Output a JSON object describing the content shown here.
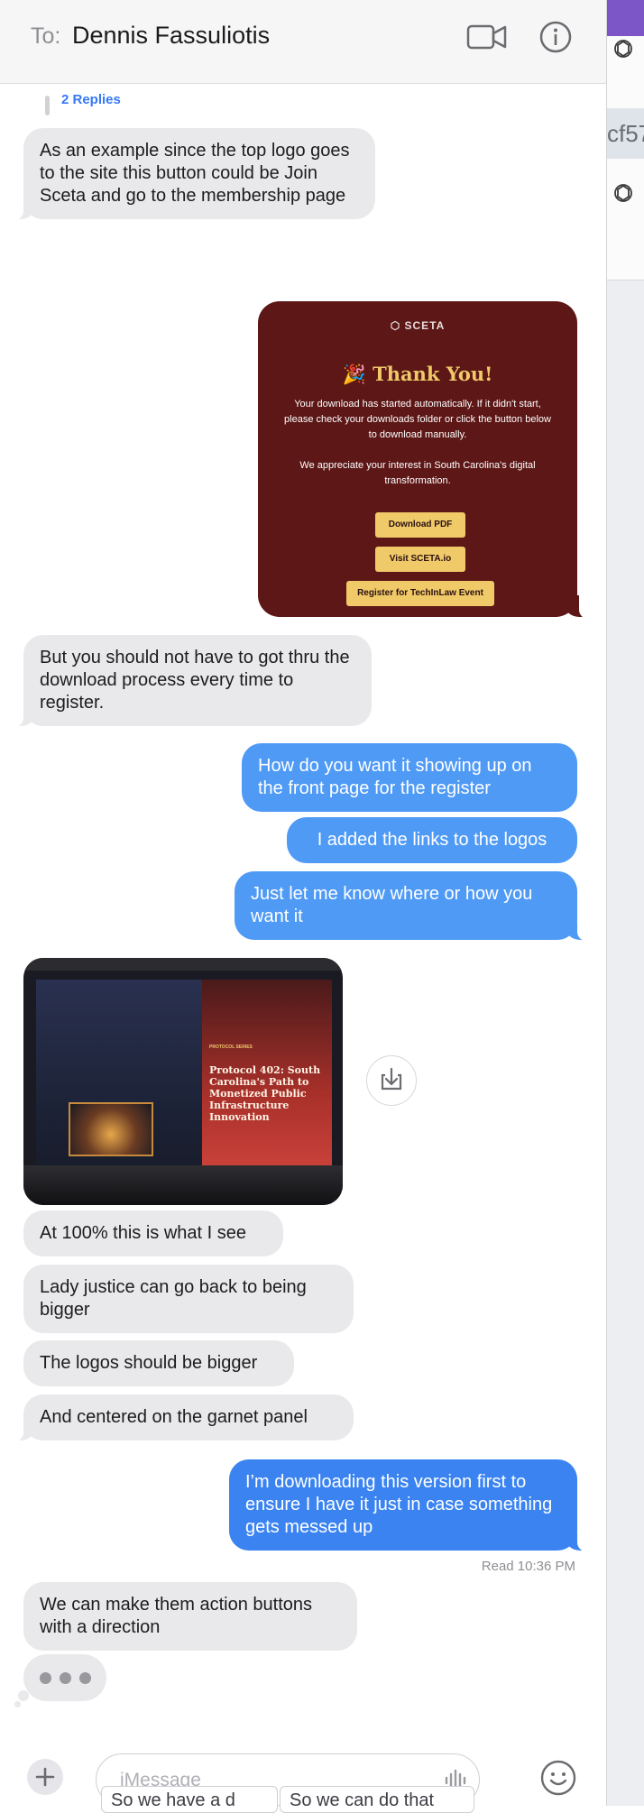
{
  "header": {
    "to_label": "To:",
    "recipient": "Dennis Fassuliotis",
    "video_icon": "video-camera-icon",
    "info_icon": "info-circle-icon"
  },
  "side_panel": {
    "partial_text": "cf57",
    "icons": [
      "openai-logo-icon",
      "openai-logo-icon"
    ]
  },
  "thread": {
    "replies_link": "2 Replies",
    "messages": [
      {
        "from": "them",
        "text": "As an example since the top logo goes to the site this button could be Join Sceta and go to the membership page"
      },
      {
        "from": "them",
        "text": "But you should not have to got thru the download process every time to register."
      },
      {
        "from": "me",
        "text": "How do you want it showing up on the front page for the register"
      },
      {
        "from": "me",
        "text": "I added the links to the logos"
      },
      {
        "from": "me",
        "text": "Just let me know where or how you want it"
      },
      {
        "from": "them",
        "text": "At 100% this is what I see"
      },
      {
        "from": "them",
        "text": "Lady justice can go back to being bigger"
      },
      {
        "from": "them",
        "text": "The logos should be bigger"
      },
      {
        "from": "them",
        "text": "And centered on the garnet panel"
      },
      {
        "from": "me",
        "text": "I’m downloading this version first to ensure I have it just in case something gets messed up"
      },
      {
        "from": "them",
        "text": "We can make them action buttons with a direction"
      }
    ],
    "read_receipt": "Read 10:36 PM"
  },
  "screenshot_card": {
    "logo": "SCETA",
    "title": "🎉 Thank You!",
    "paragraph1": "Your download has started automatically. If it didn't start, please check your downloads folder or click the button below to download manually.",
    "paragraph2": "We appreciate your interest in South Carolina's digital transformation.",
    "buttons": [
      "Download PDF",
      "Visit SCETA.io",
      "Register for TechInLaw Event"
    ]
  },
  "photo": {
    "label": "PROTOCOL SERIES",
    "title": "Protocol 402: South Carolina's Path to Monetized Public Infrastructure Innovation"
  },
  "composer": {
    "placeholder": "iMessage",
    "plus_icon": "plus-icon",
    "audio_icon": "waveform-icon",
    "emoji_icon": "emoji-smile-icon",
    "suggestions": [
      "So we have a d",
      "So we can do that"
    ]
  }
}
